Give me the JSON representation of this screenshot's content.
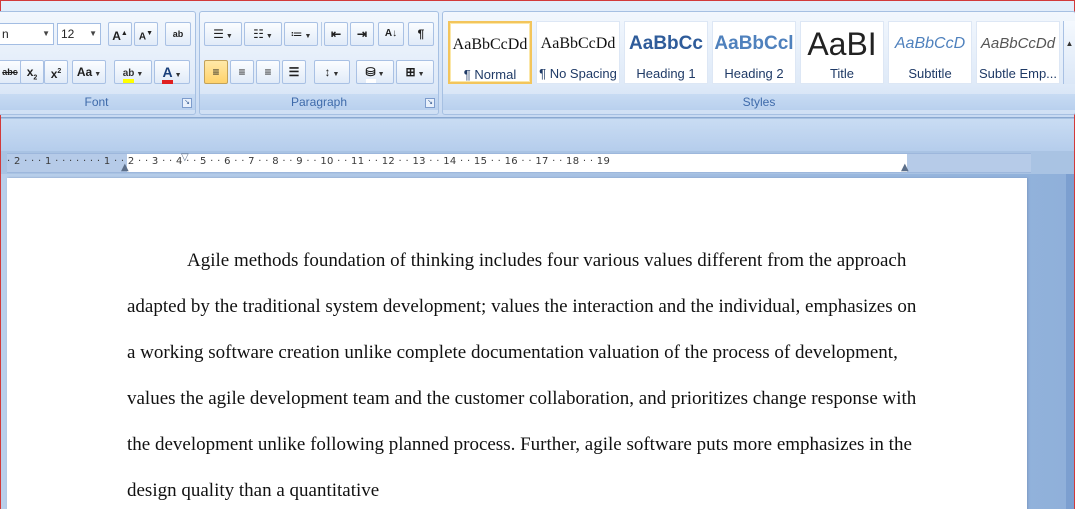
{
  "font_group": {
    "label": "Font",
    "font_name": "n",
    "font_size": "12",
    "grow_label": "A",
    "shrink_label": "A",
    "clear_format_label": "ab",
    "strike_label": "abc",
    "subscript_label": "x",
    "superscript_label": "x",
    "change_case_label": "Aa",
    "highlight_label": "ab",
    "font_color_label": "A",
    "highlight_color": "#ffff00",
    "font_color": "#e02020"
  },
  "paragraph_group": {
    "label": "Paragraph",
    "sort_label": "A↓",
    "show_marks_label": "¶"
  },
  "styles_group": {
    "label": "Styles",
    "tiles": [
      {
        "sample": "AaBbCcDd",
        "name": "¶ Normal",
        "selected": true
      },
      {
        "sample": "AaBbCcDd",
        "name": "¶ No Spacing",
        "selected": false
      },
      {
        "sample": "AaBbCc",
        "name": "Heading 1",
        "selected": false
      },
      {
        "sample": "AaBbCcl",
        "name": "Heading 2",
        "selected": false
      },
      {
        "sample": "AaBI",
        "name": "Title",
        "selected": false
      },
      {
        "sample": "AaBbCcD",
        "name": "Subtitle",
        "selected": false
      },
      {
        "sample": "AaBbCcDd",
        "name": "Subtle Emp...",
        "selected": false
      }
    ]
  },
  "ruler": {
    "ticks": "· 2 · · · 1 · · · · · · · 1 · · 2 · · 3 · · 4 · · 5 · · 6 · · 7 · · 8 · · 9 · · 10 · · 11 · · 12 · · 13 · · 14 · · 15 · · 16 · · 17 · · 18 · · 19"
  },
  "document": {
    "paragraph": "Agile methods foundation of thinking includes four various values different from the approach adapted by the traditional system development;  values the interaction and the individual, emphasizes on a working software creation unlike complete documentation valuation of the process of development, values the agile development team and the customer collaboration, and prioritizes change response with the development unlike following planned process. Further, agile software puts more emphasizes in the design quality than a quantitative"
  },
  "colors": {
    "ribbon_bg": "#dfeaf8",
    "group_label": "#3e6aaa",
    "selected_style_border": "#f3c55c",
    "heading_blue": "#4f81bd"
  }
}
